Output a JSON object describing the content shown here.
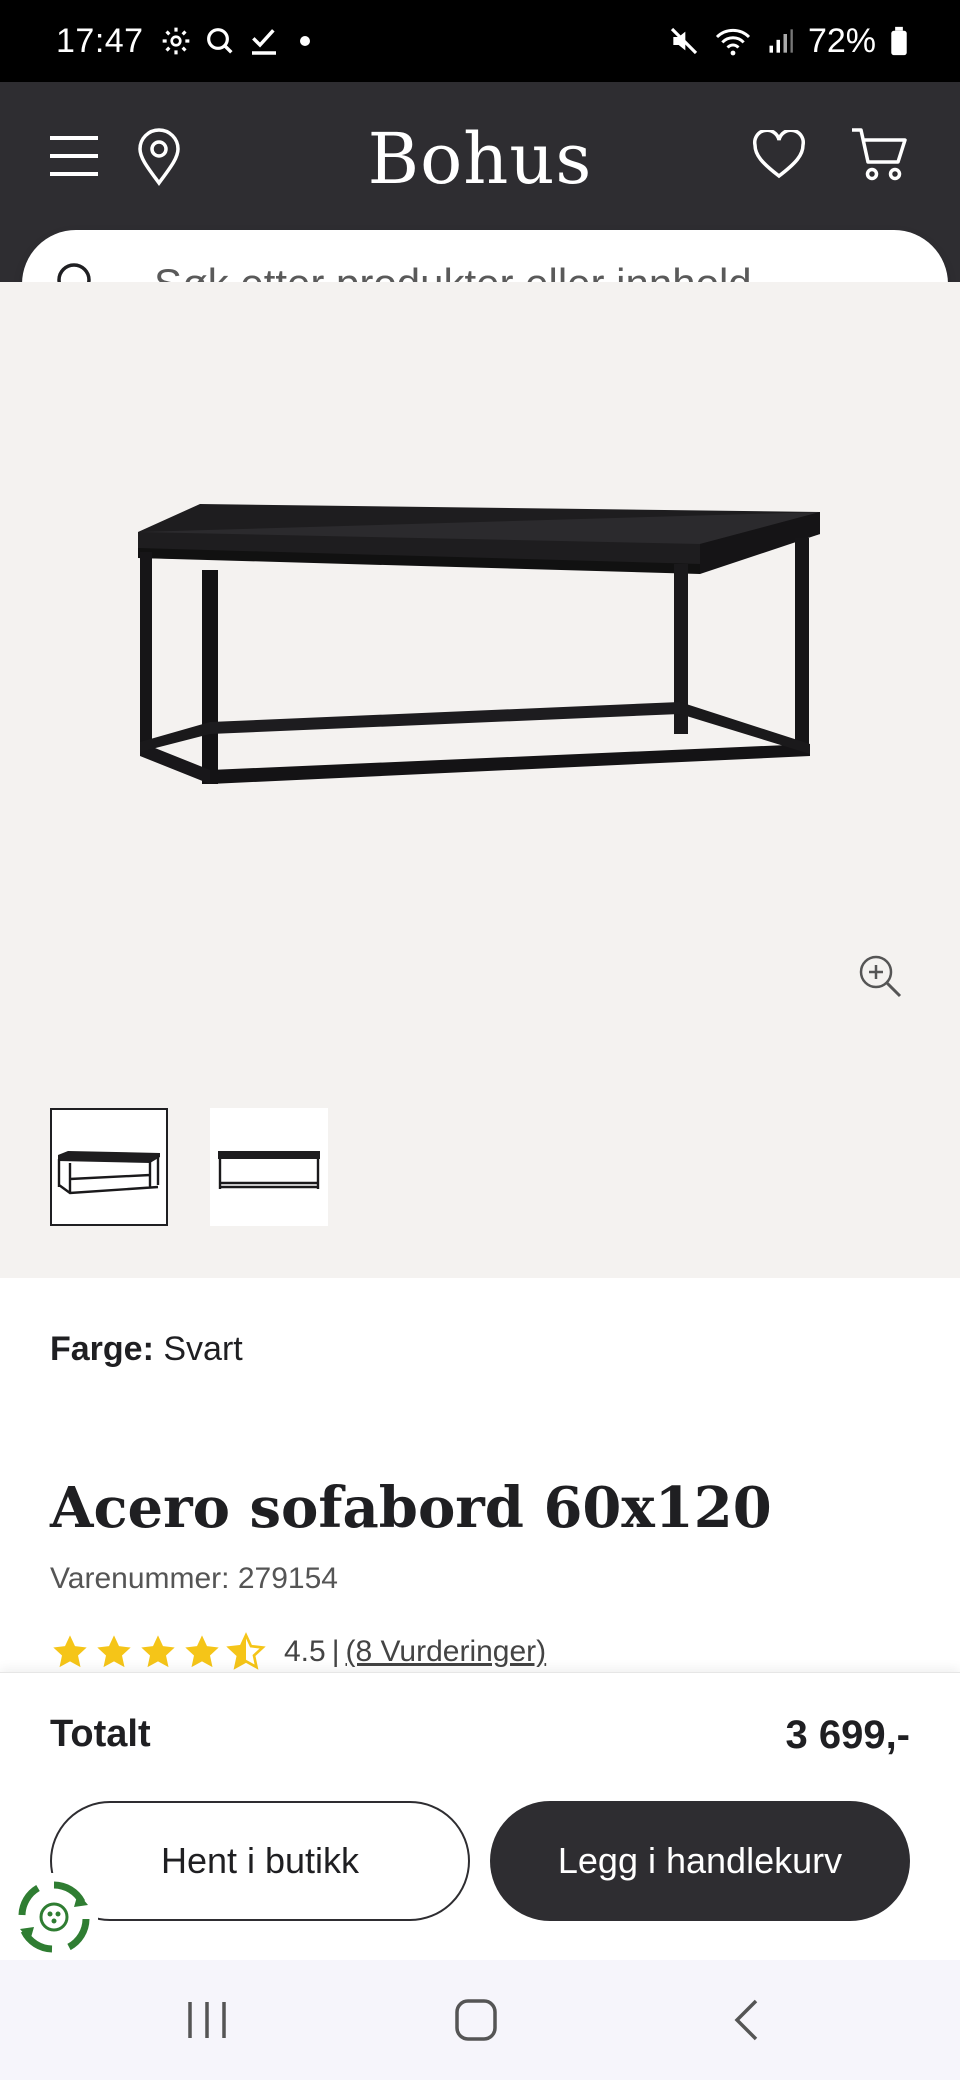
{
  "status_bar": {
    "time": "17:47",
    "battery": "72%",
    "icons": [
      "settings-icon",
      "search-icon",
      "checkmark-icon",
      "dot-icon",
      "mute-icon",
      "wifi-icon",
      "signal-icon",
      "battery-icon"
    ]
  },
  "header": {
    "logo": "Bohus",
    "bg_color": "#2e2d31",
    "icons": [
      "menu-icon",
      "location-icon",
      "heart-icon",
      "cart-icon"
    ]
  },
  "search": {
    "placeholder": "Søk etter produkter eller innhold ..."
  },
  "gallery": {
    "bg_color": "#f4f2f0",
    "thumbnail_count": 2,
    "active_thumbnail": 1
  },
  "product": {
    "color_label": "Farge:",
    "color_value": "Svart",
    "title": "Acero sofabord 60x120",
    "sku": "Varenummer: 279154",
    "rating_value": "4.5",
    "rating_separator": "|",
    "rating_link": "(8 Vurderinger)",
    "stars": 4.5,
    "star_color": "#f5c518"
  },
  "sticky": {
    "total_label": "Totalt",
    "total_price": "3 699,-",
    "store_button": "Hent i butikk",
    "cart_button": "Legg i handlekurv"
  },
  "navbar": {
    "icons": [
      "recent-apps-icon",
      "home-icon",
      "back-icon"
    ]
  }
}
